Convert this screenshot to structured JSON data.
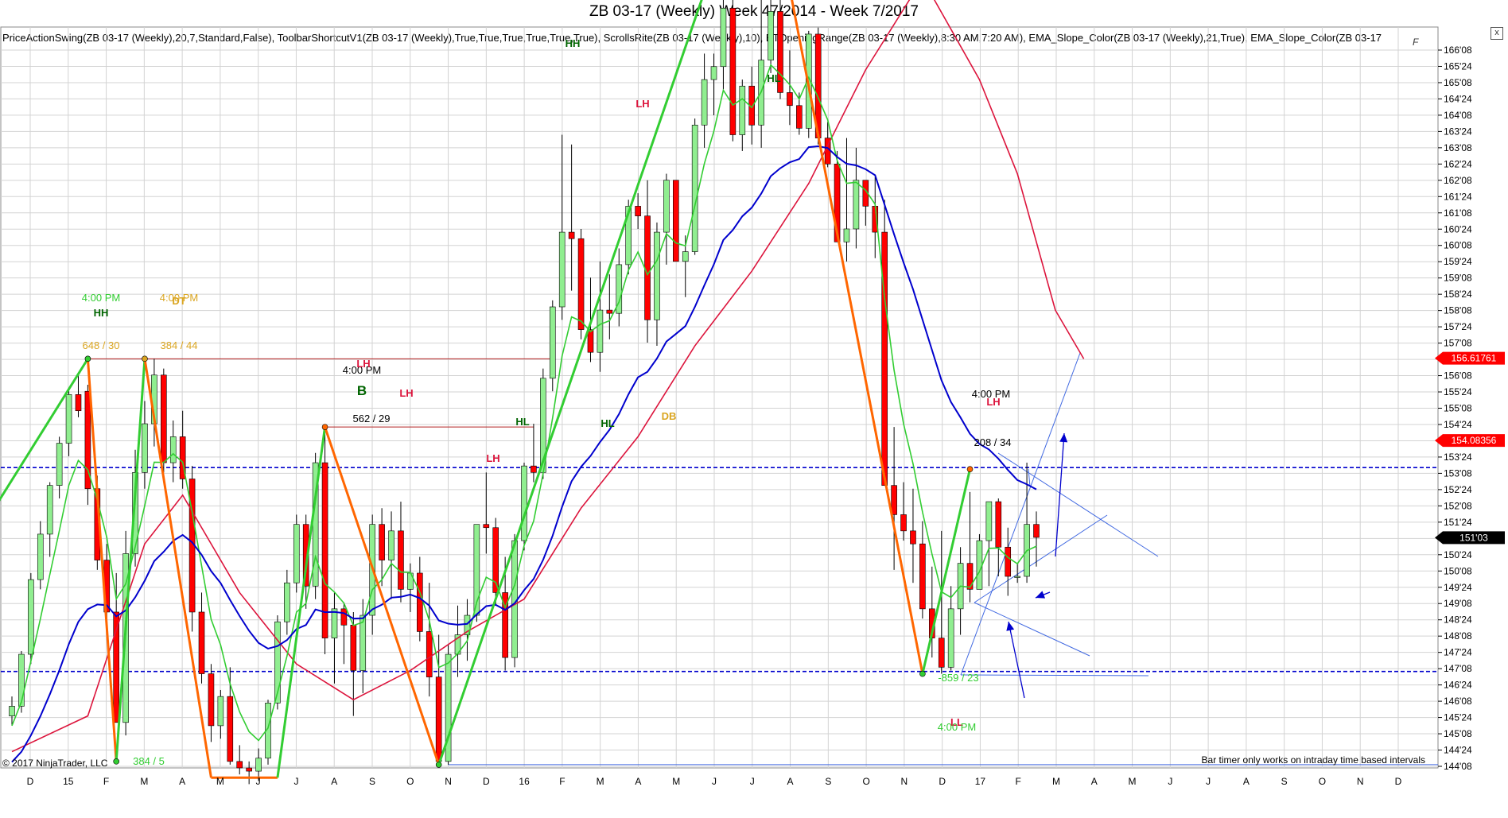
{
  "title": "ZB 03-17 (Weekly)  Week 47/2014 - Week 7/2017",
  "indicators_text": "PriceActionSwing(ZB 03-17 (Weekly),20,7,Standard,False), ToolbarShortcutV1(ZB 03-17 (Weekly),True,True,True,True,True,True), ScrollsRite(ZB 03-17 (Weekly),10), BTOpeningRange(ZB 03-17 (Weekly),8:30 AM,7:20 AM), EMA_Slope_Color(ZB 03-17 (Weekly),21,True), EMA_Slope_Color(ZB 03-17",
  "copyright": "© 2017 NinjaTrader, LLC",
  "bar_timer_text": "Bar timer only works on intraday time based intervals",
  "close_label": "x",
  "edit_label": "F",
  "colors": {
    "up_bar": "#90ee90",
    "down_bar": "#ff0000",
    "ema_fast": "#32cd32",
    "ema_mid": "#dc143c",
    "ema_slow": "#0000cd",
    "swing_up": "#32cd32",
    "swing_down": "#ff6600",
    "dash_level": "#0000cd",
    "price_tag": "#ff0000",
    "grid": "#d3d3d3"
  },
  "chart_data": {
    "type": "candlestick",
    "y_ticks": [
      "166'08",
      "165'24",
      "165'08",
      "164'24",
      "164'08",
      "163'24",
      "163'08",
      "162'24",
      "162'08",
      "161'24",
      "161'08",
      "160'24",
      "160'08",
      "159'24",
      "159'08",
      "158'24",
      "158'08",
      "157'24",
      "157'08",
      "156'24",
      "156'08",
      "155'24",
      "155'08",
      "154'24",
      "154'08",
      "153'24",
      "153'08",
      "152'24",
      "152'08",
      "151'24",
      "151'08",
      "150'24",
      "150'08",
      "149'24",
      "149'08",
      "148'24",
      "148'08",
      "147'24",
      "147'08",
      "146'24",
      "146'08",
      "145'24",
      "145'08",
      "144'24",
      "144'08"
    ],
    "x_ticks": [
      "D",
      "15",
      "F",
      "M",
      "A",
      "M",
      "J",
      "J",
      "A",
      "S",
      "O",
      "N",
      "D",
      "16",
      "F",
      "M",
      "A",
      "M",
      "J",
      "J",
      "A",
      "S",
      "O",
      "N",
      "D",
      "17",
      "F",
      "M",
      "A",
      "M",
      "J",
      "J",
      "A",
      "S",
      "O",
      "N",
      "D"
    ],
    "price_tags": [
      {
        "label": "156.61761",
        "value": 156.61761,
        "color": "#ff0000"
      },
      {
        "label": "154.08356",
        "value": 154.08356,
        "color": "#ff0000"
      },
      {
        "label": "151'03",
        "value": 151.09,
        "color": "#000000"
      }
    ],
    "dashed_levels": [
      153.25,
      146.97
    ],
    "candles": [
      [
        145.6,
        146.2,
        145.3,
        145.9
      ],
      [
        145.9,
        147.6,
        145.7,
        147.5
      ],
      [
        147.5,
        150.0,
        147.2,
        149.8
      ],
      [
        149.8,
        151.6,
        149.5,
        151.2
      ],
      [
        151.2,
        152.8,
        150.5,
        152.7
      ],
      [
        152.7,
        154.2,
        152.3,
        154.0
      ],
      [
        154.0,
        155.6,
        153.6,
        155.5
      ],
      [
        155.5,
        156.1,
        154.8,
        155.0
      ],
      [
        155.6,
        155.8,
        152.1,
        152.6
      ],
      [
        152.6,
        153.0,
        150.1,
        150.4
      ],
      [
        150.4,
        150.9,
        148.1,
        148.8
      ],
      [
        148.8,
        150.0,
        145.6,
        145.4
      ],
      [
        145.4,
        151.3,
        145.0,
        150.6
      ],
      [
        150.6,
        153.8,
        150.2,
        153.1
      ],
      [
        153.1,
        155.3,
        152.6,
        154.6
      ],
      [
        154.6,
        156.6,
        153.9,
        156.1
      ],
      [
        156.1,
        156.3,
        153.1,
        153.4
      ],
      [
        153.4,
        154.7,
        152.8,
        154.2
      ],
      [
        154.2,
        155.0,
        152.6,
        152.9
      ],
      [
        152.9,
        153.3,
        148.2,
        148.8
      ],
      [
        148.8,
        149.4,
        146.6,
        146.9
      ],
      [
        146.9,
        147.2,
        144.8,
        145.3
      ],
      [
        145.3,
        146.4,
        144.9,
        146.2
      ],
      [
        146.2,
        147.1,
        144.1,
        144.2
      ],
      [
        144.2,
        144.7,
        143.8,
        144.0
      ],
      [
        144.0,
        144.2,
        143.5,
        143.9
      ],
      [
        143.9,
        144.6,
        143.6,
        144.3
      ],
      [
        144.3,
        146.1,
        144.1,
        146.0
      ],
      [
        146.0,
        148.7,
        145.8,
        148.5
      ],
      [
        148.5,
        150.1,
        148.1,
        149.7
      ],
      [
        149.7,
        151.8,
        149.4,
        151.5
      ],
      [
        151.5,
        151.8,
        148.9,
        149.6
      ],
      [
        149.6,
        153.7,
        149.2,
        153.4
      ],
      [
        153.4,
        154.5,
        147.5,
        148.0
      ],
      [
        148.0,
        149.4,
        146.6,
        148.9
      ],
      [
        148.9,
        149.1,
        147.2,
        148.4
      ],
      [
        148.4,
        148.8,
        145.6,
        147.0
      ],
      [
        147.0,
        149.2,
        146.3,
        148.7
      ],
      [
        148.7,
        151.8,
        148.1,
        151.5
      ],
      [
        151.5,
        152.0,
        149.6,
        150.4
      ],
      [
        150.4,
        151.9,
        149.2,
        151.3
      ],
      [
        151.3,
        152.2,
        149.1,
        149.5
      ],
      [
        149.5,
        150.3,
        148.8,
        150.0
      ],
      [
        150.0,
        150.5,
        147.9,
        148.2
      ],
      [
        148.2,
        149.7,
        146.2,
        146.8
      ],
      [
        146.8,
        148.1,
        144.5,
        144.2
      ],
      [
        144.2,
        147.8,
        144.1,
        147.5
      ],
      [
        147.5,
        149.0,
        146.8,
        148.1
      ],
      [
        148.1,
        149.2,
        147.3,
        148.7
      ],
      [
        148.7,
        150.9,
        148.5,
        151.5
      ],
      [
        151.5,
        153.1,
        150.6,
        151.4
      ],
      [
        151.4,
        151.7,
        149.0,
        149.4
      ],
      [
        149.4,
        150.5,
        147.0,
        147.4
      ],
      [
        147.4,
        151.2,
        147.1,
        151.0
      ],
      [
        151.0,
        153.4,
        150.7,
        153.3
      ],
      [
        153.3,
        154.6,
        152.8,
        153.1
      ],
      [
        153.1,
        156.3,
        152.9,
        156.0
      ],
      [
        156.0,
        158.4,
        155.6,
        158.2
      ],
      [
        158.2,
        163.5,
        157.8,
        160.5
      ],
      [
        160.5,
        163.2,
        158.7,
        160.3
      ],
      [
        160.3,
        160.6,
        157.2,
        157.5
      ],
      [
        157.5,
        159.1,
        156.5,
        156.8
      ],
      [
        156.8,
        159.6,
        156.2,
        158.1
      ],
      [
        158.1,
        159.2,
        157.2,
        158.0
      ],
      [
        158.0,
        160.0,
        157.6,
        159.5
      ],
      [
        159.5,
        161.5,
        159.2,
        161.3
      ],
      [
        161.3,
        161.7,
        160.6,
        161.0
      ],
      [
        161.0,
        162.1,
        157.1,
        157.8
      ],
      [
        157.8,
        160.8,
        157.0,
        160.5
      ],
      [
        160.5,
        162.3,
        159.5,
        162.1
      ],
      [
        162.1,
        162.1,
        159.6,
        159.6
      ],
      [
        159.6,
        160.4,
        158.5,
        159.9
      ],
      [
        159.9,
        164.0,
        159.8,
        163.8
      ],
      [
        163.8,
        166.0,
        163.1,
        165.2
      ],
      [
        165.2,
        166.0,
        164.1,
        165.6
      ],
      [
        165.6,
        167.9,
        164.9,
        167.4
      ],
      [
        167.4,
        168.0,
        163.3,
        163.5
      ],
      [
        163.5,
        165.2,
        163.0,
        165.0
      ],
      [
        165.0,
        165.6,
        163.2,
        163.8
      ],
      [
        163.8,
        168.0,
        163.1,
        165.8
      ],
      [
        165.8,
        168.0,
        165.4,
        167.3
      ],
      [
        167.3,
        167.8,
        164.6,
        164.8
      ],
      [
        164.8,
        166.1,
        163.8,
        164.4
      ],
      [
        164.4,
        164.8,
        163.5,
        163.7
      ],
      [
        163.7,
        166.7,
        163.4,
        166.6
      ],
      [
        166.6,
        166.8,
        163.2,
        163.4
      ],
      [
        163.4,
        163.9,
        162.5,
        162.6
      ],
      [
        162.6,
        163.0,
        160.2,
        160.2
      ],
      [
        160.2,
        163.4,
        159.6,
        160.6
      ],
      [
        160.6,
        163.1,
        160.0,
        162.1
      ],
      [
        162.1,
        161.5,
        160.7,
        161.3
      ],
      [
        161.3,
        162.2,
        159.7,
        160.5
      ],
      [
        160.5,
        161.5,
        158.3,
        152.7
      ],
      [
        152.7,
        154.5,
        150.1,
        151.8
      ],
      [
        151.8,
        152.8,
        151.0,
        151.3
      ],
      [
        151.3,
        152.6,
        149.7,
        150.9
      ],
      [
        150.9,
        151.6,
        148.6,
        148.9
      ],
      [
        148.9,
        150.2,
        147.4,
        148.0
      ],
      [
        148.0,
        151.3,
        146.9,
        147.1
      ],
      [
        147.1,
        149.6,
        147.0,
        148.9
      ],
      [
        148.9,
        150.8,
        148.1,
        150.3
      ],
      [
        150.3,
        152.5,
        149.1,
        149.5
      ],
      [
        149.5,
        151.2,
        150.8,
        151.0
      ],
      [
        151.0,
        152.2,
        149.6,
        152.2
      ],
      [
        152.2,
        152.3,
        149.9,
        150.8
      ],
      [
        150.8,
        151.4,
        149.3,
        149.9
      ],
      [
        149.9,
        150.3,
        149.7,
        149.9
      ],
      [
        149.9,
        153.4,
        149.7,
        151.5
      ],
      [
        151.5,
        151.9,
        150.2,
        151.1
      ]
    ],
    "ema_mid_points": [
      [
        0,
        144.5
      ],
      [
        8,
        145.6
      ],
      [
        14,
        150.9
      ],
      [
        18,
        152.4
      ],
      [
        24,
        149.4
      ],
      [
        30,
        147.2
      ],
      [
        36,
        146.1
      ],
      [
        42,
        147.0
      ],
      [
        48,
        148.2
      ],
      [
        54,
        149.2
      ],
      [
        60,
        152.0
      ],
      [
        66,
        154.2
      ],
      [
        72,
        157.0
      ],
      [
        78,
        159.3
      ],
      [
        84,
        162.0
      ],
      [
        90,
        165.5
      ],
      [
        96,
        168.3
      ],
      [
        102,
        165.2
      ],
      [
        106,
        162.3
      ],
      [
        110,
        158.1
      ],
      [
        113,
        156.6
      ]
    ],
    "annotations": [
      {
        "text": "4:00 PM",
        "color": "#32cd32"
      },
      {
        "text": "HH",
        "color": "#006400"
      },
      {
        "text": "4:00 PM",
        "color": "#daa520"
      },
      {
        "text": "DT",
        "color": "#daa520"
      },
      {
        "text": "648 / 30",
        "color": "#daa520"
      },
      {
        "text": "384 / 44",
        "color": "#daa520"
      },
      {
        "text": "4:00 PM",
        "color": "#000000"
      },
      {
        "text": "B",
        "color": "#006400"
      },
      {
        "text": "LH",
        "color": "#dc143c"
      },
      {
        "text": "LH",
        "color": "#dc143c"
      },
      {
        "text": "562 / 29",
        "color": "#000000"
      },
      {
        "text": "LH",
        "color": "#dc143c"
      },
      {
        "text": "HL",
        "color": "#006400"
      },
      {
        "text": "HL",
        "color": "#006400"
      },
      {
        "text": "DB",
        "color": "#daa520"
      },
      {
        "text": "LH",
        "color": "#dc143c"
      },
      {
        "text": "HH",
        "color": "#006400"
      },
      {
        "text": "HL",
        "color": "#006400"
      },
      {
        "text": "4:00 PM",
        "color": "#000000"
      },
      {
        "text": "LH",
        "color": "#dc143c"
      },
      {
        "text": "208 / 34",
        "color": "#000000"
      },
      {
        "text": "-859 / 23",
        "color": "#32cd32"
      },
      {
        "text": "LL",
        "color": "#dc143c"
      },
      {
        "text": "4:00 PM",
        "color": "#32cd32"
      },
      {
        "text": "384 / 5",
        "color": "#32cd32"
      }
    ]
  }
}
